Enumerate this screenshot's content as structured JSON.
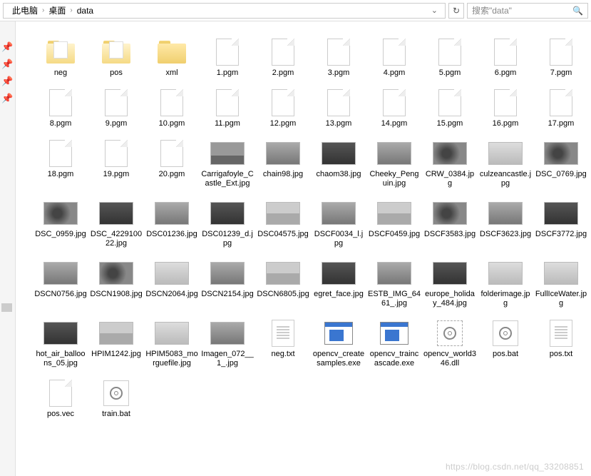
{
  "breadcrumb": {
    "parts": [
      "此电脑",
      "桌面",
      "data"
    ]
  },
  "search": {
    "placeholder": "搜索\"data\""
  },
  "items": [
    {
      "name": "neg",
      "type": "folder"
    },
    {
      "name": "pos",
      "type": "folder"
    },
    {
      "name": "xml",
      "type": "folder-empty"
    },
    {
      "name": "1.pgm",
      "type": "file"
    },
    {
      "name": "2.pgm",
      "type": "file"
    },
    {
      "name": "3.pgm",
      "type": "file"
    },
    {
      "name": "4.pgm",
      "type": "file"
    },
    {
      "name": "5.pgm",
      "type": "file"
    },
    {
      "name": "6.pgm",
      "type": "file"
    },
    {
      "name": "7.pgm",
      "type": "file"
    },
    {
      "name": "8.pgm",
      "type": "file"
    },
    {
      "name": "9.pgm",
      "type": "file"
    },
    {
      "name": "10.pgm",
      "type": "file"
    },
    {
      "name": "11.pgm",
      "type": "file"
    },
    {
      "name": "12.pgm",
      "type": "file"
    },
    {
      "name": "13.pgm",
      "type": "file"
    },
    {
      "name": "14.pgm",
      "type": "file"
    },
    {
      "name": "15.pgm",
      "type": "file"
    },
    {
      "name": "16.pgm",
      "type": "file"
    },
    {
      "name": "17.pgm",
      "type": "file"
    },
    {
      "name": "18.pgm",
      "type": "file"
    },
    {
      "name": "19.pgm",
      "type": "file"
    },
    {
      "name": "20.pgm",
      "type": "file"
    },
    {
      "name": "Carrigafoyle_Castle_Ext.jpg",
      "type": "thumb",
      "tone": "castle"
    },
    {
      "name": "chain98.jpg",
      "type": "thumb",
      "tone": "mid"
    },
    {
      "name": "chaom38.jpg",
      "type": "thumb",
      "tone": "dark"
    },
    {
      "name": "Cheeky_Penguin.jpg",
      "type": "thumb",
      "tone": "mid"
    },
    {
      "name": "CRW_0384.jpg",
      "type": "thumb",
      "tone": "bird"
    },
    {
      "name": "culzeancastle.jpg",
      "type": "thumb",
      "tone": "light"
    },
    {
      "name": "DSC_0769.jpg",
      "type": "thumb",
      "tone": "bird"
    },
    {
      "name": "DSC_0959.jpg",
      "type": "thumb",
      "tone": "bird"
    },
    {
      "name": "DSC_422910022.jpg",
      "type": "thumb",
      "tone": "dark"
    },
    {
      "name": "DSC01236.jpg",
      "type": "thumb",
      "tone": "mid"
    },
    {
      "name": "DSC01239_d.jpg",
      "type": "thumb",
      "tone": "dark"
    },
    {
      "name": "DSC04575.jpg",
      "type": "thumb",
      "tone": "sky"
    },
    {
      "name": "DSCF0034_l.jpg",
      "type": "thumb",
      "tone": "mid"
    },
    {
      "name": "DSCF0459.jpg",
      "type": "thumb",
      "tone": "sky"
    },
    {
      "name": "DSCF3583.jpg",
      "type": "thumb",
      "tone": "bird"
    },
    {
      "name": "DSCF3623.jpg",
      "type": "thumb",
      "tone": "mid"
    },
    {
      "name": "DSCF3772.jpg",
      "type": "thumb",
      "tone": "dark"
    },
    {
      "name": "DSCN0756.jpg",
      "type": "thumb",
      "tone": "mid"
    },
    {
      "name": "DSCN1908.jpg",
      "type": "thumb",
      "tone": "bird"
    },
    {
      "name": "DSCN2064.jpg",
      "type": "thumb",
      "tone": "light"
    },
    {
      "name": "DSCN2154.jpg",
      "type": "thumb",
      "tone": "mid"
    },
    {
      "name": "DSCN6805.jpg",
      "type": "thumb",
      "tone": "sky"
    },
    {
      "name": "egret_face.jpg",
      "type": "thumb",
      "tone": "dark"
    },
    {
      "name": "ESTB_IMG_6461_.jpg",
      "type": "thumb",
      "tone": "mid"
    },
    {
      "name": "europe_holiday_484.jpg",
      "type": "thumb",
      "tone": "dark"
    },
    {
      "name": "folderimage.jpg",
      "type": "thumb",
      "tone": "light"
    },
    {
      "name": "FullIceWater.jpg",
      "type": "thumb",
      "tone": "light"
    },
    {
      "name": "hot_air_balloons_05.jpg",
      "type": "thumb",
      "tone": "dark"
    },
    {
      "name": "HPIM1242.jpg",
      "type": "thumb",
      "tone": "sky"
    },
    {
      "name": "HPIM5083_morguefile.jpg",
      "type": "thumb",
      "tone": "light"
    },
    {
      "name": "Imagen_072__1_.jpg",
      "type": "thumb",
      "tone": "mid"
    },
    {
      "name": "neg.txt",
      "type": "txt"
    },
    {
      "name": "opencv_createsamples.exe",
      "type": "exe"
    },
    {
      "name": "opencv_traincascade.exe",
      "type": "exe"
    },
    {
      "name": "opencv_world346.dll",
      "type": "dll"
    },
    {
      "name": "pos.bat",
      "type": "bat"
    },
    {
      "name": "pos.txt",
      "type": "txt"
    },
    {
      "name": "pos.vec",
      "type": "file"
    },
    {
      "name": "train.bat",
      "type": "bat"
    }
  ],
  "watermark": "https://blog.csdn.net/qq_33208851"
}
